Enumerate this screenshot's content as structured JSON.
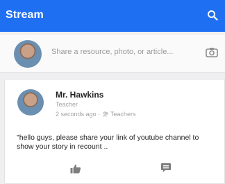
{
  "header": {
    "title": "Stream",
    "search_icon": "search-icon",
    "background": "#1f6ff3"
  },
  "composer": {
    "placeholder": "Share a resource, photo, or article...",
    "camera_icon": "camera-icon"
  },
  "post": {
    "author": "Mr. Hawkins",
    "role": "Teacher",
    "time": "2 seconds ago",
    "separator": "·",
    "audience": "Teachers",
    "message": "\"hello guys, please share your link of youtube channel to show your story in recount ..",
    "actions": [
      "thumbs-up-icon",
      "comment-icon"
    ]
  }
}
